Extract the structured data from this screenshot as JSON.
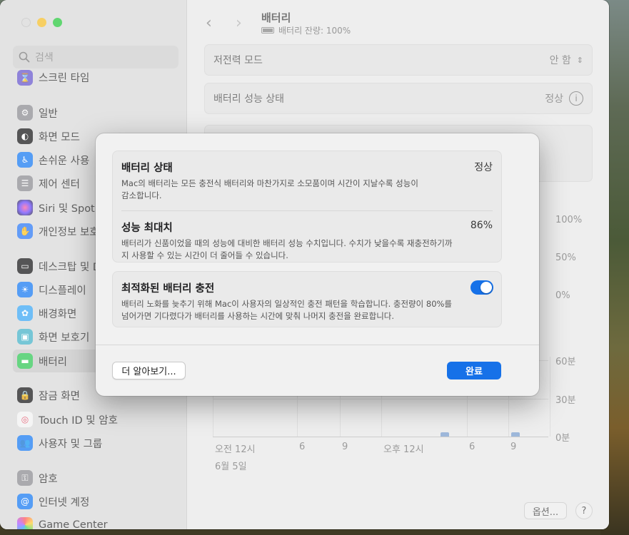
{
  "sidebar": {
    "search_placeholder": "검색",
    "items": [
      {
        "label": "스크린 타임",
        "icon": "hourglass-icon",
        "color": "#6a5acd"
      },
      {
        "label": "일반",
        "icon": "gear-icon",
        "color": "#8e8e93"
      },
      {
        "label": "화면 모드",
        "icon": "appearance-icon",
        "color": "#1c1c1e"
      },
      {
        "label": "손쉬운 사용",
        "icon": "accessibility-icon",
        "color": "#1d7cf2"
      },
      {
        "label": "제어 센터",
        "icon": "control-center-icon",
        "color": "#8e8e93"
      },
      {
        "label": "Siri 및 Spotlight",
        "icon": "siri-icon",
        "color": "#b04fd6"
      },
      {
        "label": "개인정보 보호 및 보안",
        "icon": "hand-icon",
        "color": "#2f7bf5"
      },
      {
        "label": "데스크탑 및 Dock",
        "icon": "dock-icon",
        "color": "#1c1c1e"
      },
      {
        "label": "디스플레이",
        "icon": "sun-icon",
        "color": "#1d7cf2"
      },
      {
        "label": "배경화면",
        "icon": "flower-icon",
        "color": "#3fa9f5"
      },
      {
        "label": "화면 보호기",
        "icon": "screensaver-icon",
        "color": "#49b3c9"
      },
      {
        "label": "배터리",
        "icon": "battery-icon",
        "color": "#34c759"
      },
      {
        "label": "잠금 화면",
        "icon": "lock-icon",
        "color": "#1c1c1e"
      },
      {
        "label": "Touch ID 및 암호",
        "icon": "fingerprint-icon",
        "color": "#f2f2f2"
      },
      {
        "label": "사용자 및 그룹",
        "icon": "users-icon",
        "color": "#1d7cf2"
      },
      {
        "label": "암호",
        "icon": "key-icon",
        "color": "#8e8e93"
      },
      {
        "label": "인터넷 계정",
        "icon": "at-icon",
        "color": "#1d7cf2"
      },
      {
        "label": "Game Center",
        "icon": "game-center-icon",
        "color": "#e9e9e9"
      }
    ]
  },
  "main": {
    "title": "배터리",
    "battery_status": "배터리 잔량: 100%",
    "low_power_label": "저전력 모드",
    "low_power_value": "안 함",
    "health_label": "배터리 성능 상태",
    "health_value": "정상",
    "chart_y1": [
      "100%",
      "50%",
      "0%"
    ],
    "chart_y2": [
      "60분",
      "30분",
      "0분"
    ],
    "chart_x": [
      "오전 12시",
      "6",
      "9",
      "오후 12시",
      "6",
      "9"
    ],
    "chart_date": "6월 5일",
    "options_button": "옵션...",
    "help_button": "?"
  },
  "modal": {
    "battery_condition_title": "배터리 상태",
    "battery_condition_value": "정상",
    "battery_condition_desc": "Mac의 배터리는 모든 충전식 배터리와 마찬가지로 소모품이며 시간이 지날수록 성능이 감소합니다.",
    "max_capacity_title": "성능 최대치",
    "max_capacity_value": "86%",
    "max_capacity_desc": "배터리가 신품이었을 때의 성능에 대비한 배터리 성능 수치입니다. 수치가 낮을수록 재충전하기까지 사용할 수 있는 시간이 더 줄어들 수 있습니다.",
    "optimized_title": "최적화된 배터리 충전",
    "optimized_desc": "배터리 노화를 늦추기 위해 Mac이 사용자의 일상적인 충전 패턴을 학습합니다. 충전량이 80%를 넘어가면 기다렸다가 배터리를 사용하는 시간에 맞춰 나머지 충전을 완료합니다.",
    "optimized_enabled": true,
    "learn_more": "더 알아보기...",
    "done": "완료",
    "accent": "#1671e8"
  }
}
